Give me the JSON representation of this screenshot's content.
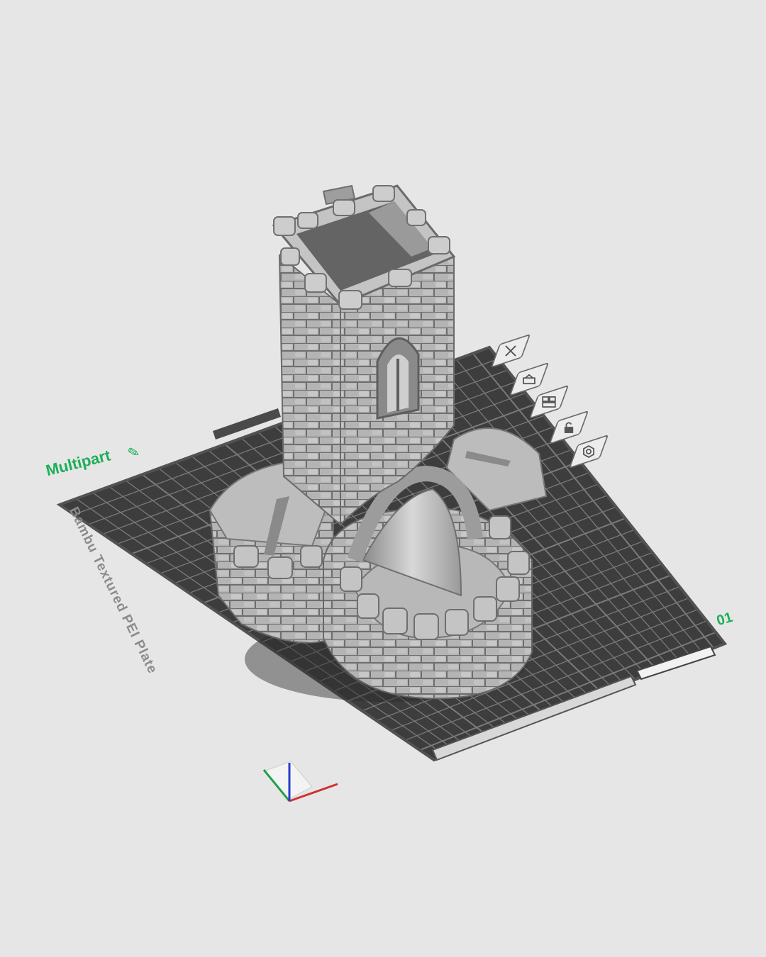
{
  "plate": {
    "name": "Multipart",
    "number": "01",
    "type_label": "Bambu Textured PEI Plate"
  },
  "plate_toolbar": [
    {
      "id": "close",
      "icon": "close-icon"
    },
    {
      "id": "orient",
      "icon": "auto-orient-icon"
    },
    {
      "id": "arrange",
      "icon": "arrange-icon"
    },
    {
      "id": "lock",
      "icon": "lock-icon"
    },
    {
      "id": "settings",
      "icon": "plate-settings-icon"
    }
  ],
  "axes": {
    "x_color": "#d23030",
    "y_color": "#22a04a",
    "z_color": "#2a3ad0"
  },
  "colors": {
    "background": "#e6e6e6",
    "plate": "#3d3d3d",
    "grid": "#7a7a7a",
    "model": "#a9a9a9",
    "accent": "#1eae5a"
  }
}
